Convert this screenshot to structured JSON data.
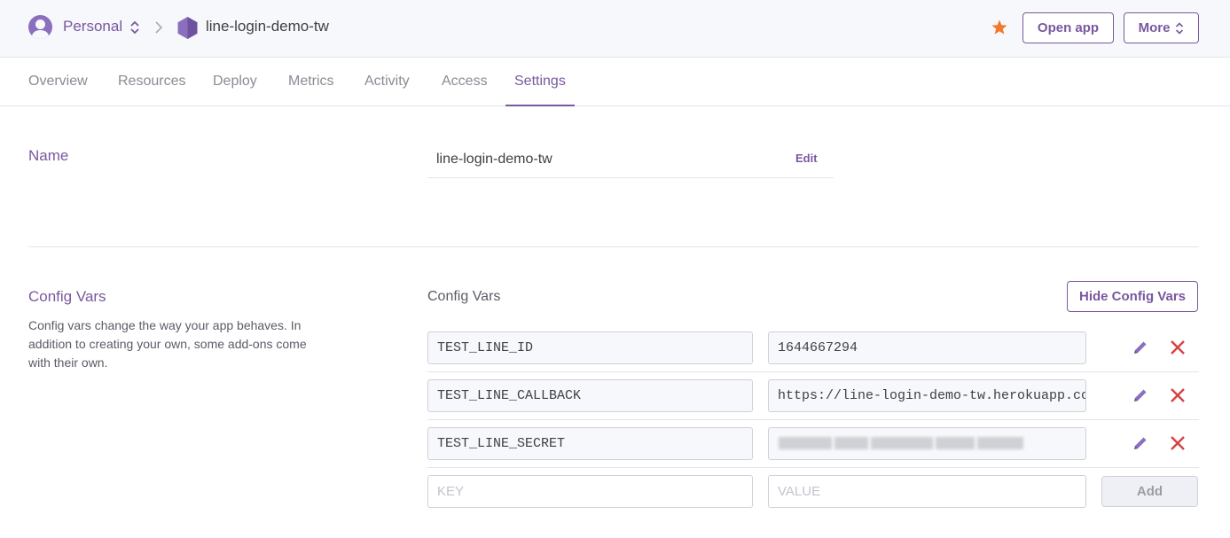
{
  "header": {
    "team_name": "Personal",
    "app_name": "line-login-demo-tw",
    "open_app_label": "Open app",
    "more_label": "More",
    "star_color": "#f0792b",
    "accent": "#79589f"
  },
  "tabs": [
    {
      "label": "Overview"
    },
    {
      "label": "Resources"
    },
    {
      "label": "Deploy"
    },
    {
      "label": "Metrics"
    },
    {
      "label": "Activity"
    },
    {
      "label": "Access"
    },
    {
      "label": "Settings",
      "active": true
    }
  ],
  "name_section": {
    "title": "Name",
    "value": "line-login-demo-tw",
    "edit_label": "Edit"
  },
  "config_vars": {
    "title": "Config Vars",
    "description": "Config vars change the way your app behaves. In addition to creating your own, some add-ons come with their own.",
    "subheading": "Config Vars",
    "hide_button_label": "Hide Config Vars",
    "rows": [
      {
        "key": "TEST_LINE_ID",
        "value": "1644667294"
      },
      {
        "key": "TEST_LINE_CALLBACK",
        "value": "https://line-login-demo-tw.herokuapp.com"
      },
      {
        "key": "TEST_LINE_SECRET",
        "value": "",
        "redacted": true
      }
    ],
    "new_key_placeholder": "KEY",
    "new_value_placeholder": "VALUE",
    "add_label": "Add"
  }
}
